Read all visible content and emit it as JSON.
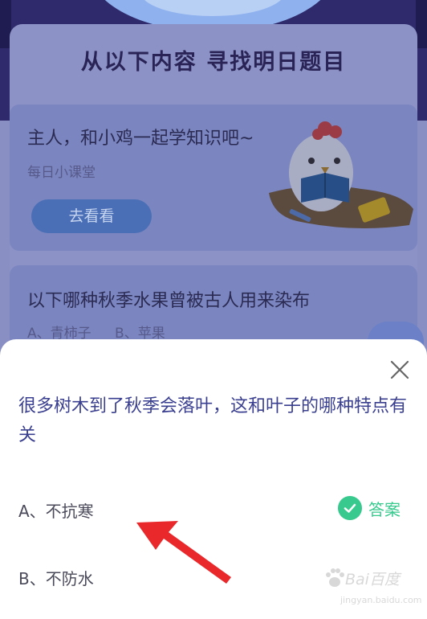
{
  "background": {
    "section_title": "从以下内容 寻找明日题目",
    "card1": {
      "title": "主人，和小鸡一起学知识吧~",
      "subtitle": "每日小课堂",
      "button_label": "去看看"
    },
    "card2": {
      "question": "以下哪种秋季水果曾被古人用来染布",
      "option_a": "A、青柿子",
      "option_b": "B、苹果"
    }
  },
  "sheet": {
    "question": "很多树木到了秋季会落叶，这和叶子的哪种特点有关",
    "option_a": "A、不抗寒",
    "option_b": "B、不防水",
    "answer_label": "答案",
    "colors": {
      "question": "#3a3f8f",
      "answer": "#37c98d"
    }
  },
  "watermark": {
    "text": "Bai百度",
    "url": "jingyan.baidu.com"
  },
  "icons": {
    "close": "close-icon",
    "check": "check-icon",
    "arrow": "red-arrow-icon",
    "mascot": "chick-mascot"
  }
}
